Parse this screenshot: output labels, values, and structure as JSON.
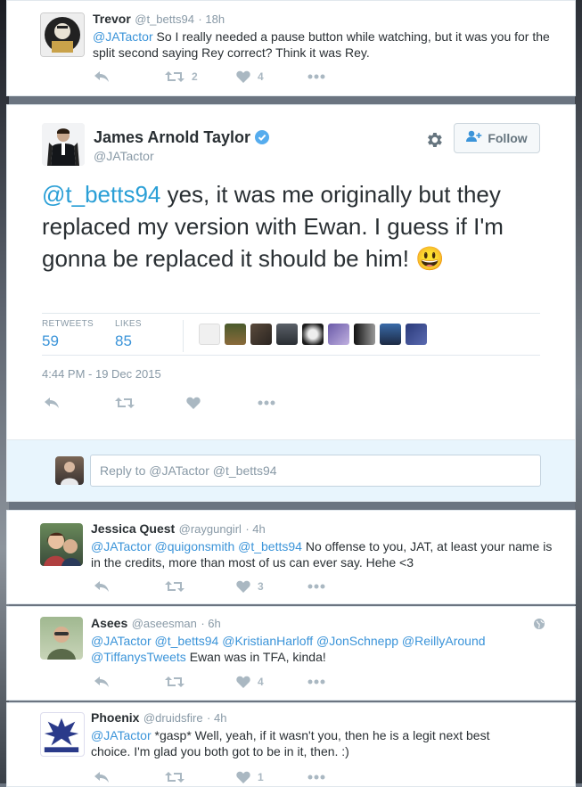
{
  "top_tweet": {
    "name": "Trevor",
    "handle": "@t_betts94",
    "time": "18h",
    "mention": "@JATactor",
    "text": " So I really needed a pause button while watching, but it was you for the split second saying Rey correct? Think it was Rey.",
    "retweets": "2",
    "likes": "4"
  },
  "main_tweet": {
    "name": "James Arnold Taylor",
    "handle": "@JATactor",
    "follow_label": "Follow",
    "mention": "@t_betts94",
    "text": " yes, it was me originally but they replaced my version with Ewan. I guess if I'm gonna be replaced it should be him! ",
    "emoji": "😃",
    "retweets_label": "RETWEETS",
    "retweets": "59",
    "likes_label": "LIKES",
    "likes": "85",
    "timestamp": "4:44 PM - 19 Dec 2015"
  },
  "reply_box": {
    "placeholder": "Reply to @JATactor @t_betts94"
  },
  "replies": [
    {
      "name": "Jessica Quest",
      "handle": "@raygungirl",
      "time": "· 4h",
      "mentions": "@JATactor @quigonsmith @t_betts94",
      "text": " No offense to you, JAT, at least your name is in the credits, more than most of us can ever say. Hehe <3",
      "likes": "3"
    },
    {
      "name": "Asees",
      "handle": "@aseesman",
      "time": "· 6h",
      "mentions": "@JATactor @t_betts94 @KristianHarloff @JonSchnepp @ReillyAround @TiffanysTweets",
      "text": " Ewan was in TFA, kinda!",
      "likes": "4"
    },
    {
      "name": "Phoenix",
      "handle": "@druidsfire",
      "time": "· 4h",
      "mentions": "@JATactor",
      "text": " *gasp*  Well, yeah, if it wasn't you, then he is a legit next best choice.  I'm glad you both got to be in it, then. :)",
      "likes": "1"
    }
  ],
  "colors": {
    "link": "#3b94d9",
    "mention_large": "#2a9fd6",
    "text": "#292f33",
    "muted": "#8899a6",
    "action": "#aab8c2",
    "verified": "#55acee",
    "reply_bg": "#e8f5fd"
  }
}
